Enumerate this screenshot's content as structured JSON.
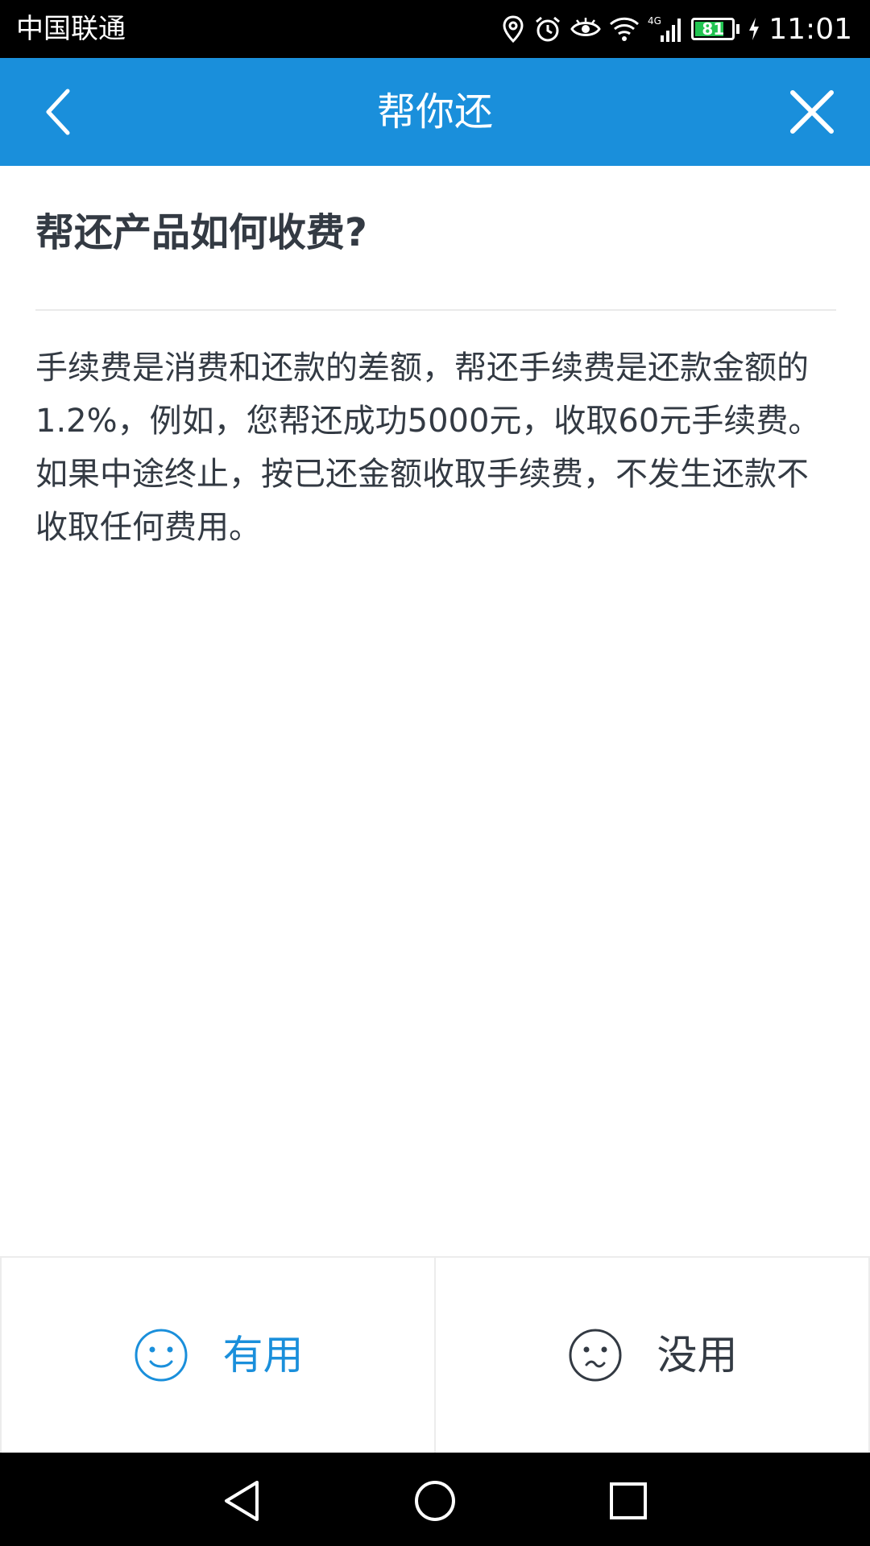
{
  "status_bar": {
    "carrier": "中国联通",
    "network": "4G",
    "battery": "81",
    "time": "11:01"
  },
  "app_bar": {
    "title": "帮你还",
    "back_icon": "back-arrow-icon",
    "close_icon": "close-icon"
  },
  "article": {
    "question": "帮还产品如何收费?",
    "answer": "手续费是消费和还款的差额，帮还手续费是还款金额的1.2%，例如，您帮还成功5000元，收取60元手续费。如果中途终止，按已还金额收取手续费，不发生还款不收取任何费用。"
  },
  "feedback": {
    "useful_label": "有用",
    "useless_label": "没用",
    "useful_color": "#1a8fdb",
    "useless_color": "#333a43"
  },
  "colors": {
    "brand": "#1a8fdb",
    "battery_green": "#22c552"
  }
}
